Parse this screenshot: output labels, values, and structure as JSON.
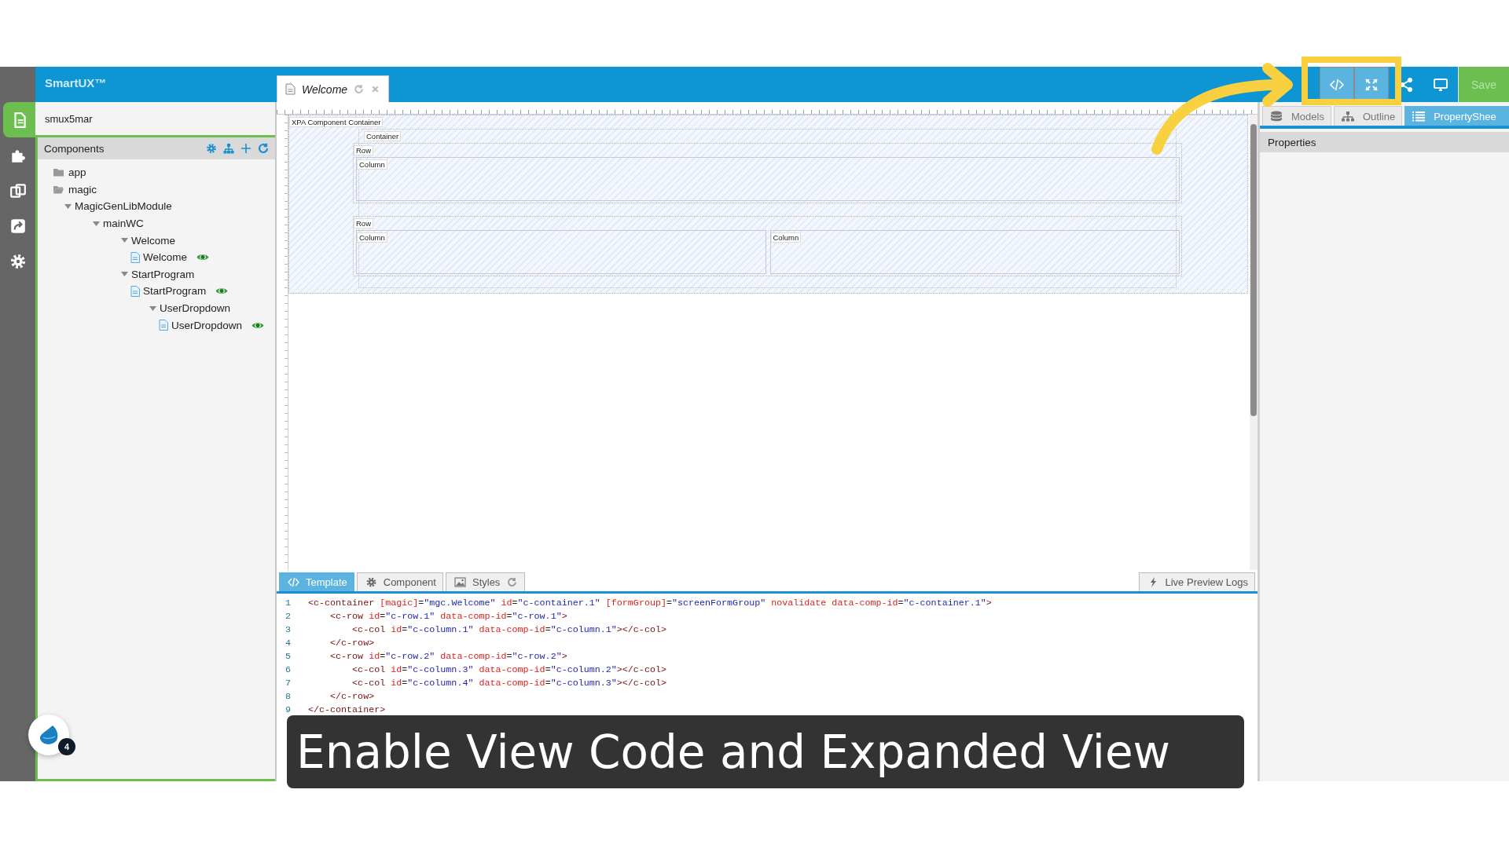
{
  "header": {
    "brand": "SmartUX™"
  },
  "rail": [
    {
      "selected": true
    },
    {
      "selected": false
    },
    {
      "selected": false
    },
    {
      "selected": false
    },
    {
      "selected": false
    }
  ],
  "document_tabs": [
    {
      "title": "Welcome",
      "selected": true
    }
  ],
  "toolbar": [
    {
      "kind": "code",
      "on": true
    },
    {
      "kind": "expand",
      "on": true
    },
    {
      "kind": "share",
      "on": false
    },
    {
      "kind": "monitor",
      "on": false
    }
  ],
  "save_button": {
    "label": "Save",
    "disabled": true
  },
  "project": {
    "name": "smux5mar"
  },
  "components": {
    "title": "Components",
    "tree": [
      {
        "label": "app",
        "kind": "folder",
        "expanded": false
      },
      {
        "label": "magic",
        "kind": "folder",
        "expanded": true,
        "children": [
          {
            "label": "MagicGenLibModule",
            "kind": "group",
            "expanded": true,
            "children": [
              {
                "label": "mainWC",
                "kind": "group",
                "expanded": true,
                "children": [
                  {
                    "label": "Welcome",
                    "kind": "group",
                    "expanded": true,
                    "children": [
                      {
                        "label": "Welcome",
                        "kind": "file",
                        "previewed": true
                      }
                    ]
                  },
                  {
                    "label": "StartProgram",
                    "kind": "group",
                    "expanded": true,
                    "children": [
                      {
                        "label": "StartProgram",
                        "kind": "file",
                        "previewed": true
                      },
                      {
                        "label": "UserDropdown",
                        "kind": "group",
                        "expanded": true,
                        "children": [
                          {
                            "label": "UserDropdown",
                            "kind": "file",
                            "previewed": true
                          }
                        ]
                      }
                    ]
                  }
                ]
              }
            ]
          }
        ]
      }
    ]
  },
  "designer": {
    "label": "XPA Component Container",
    "kind": "root",
    "children": [
      {
        "label": "Container",
        "kind": "container",
        "children": [
          {
            "label": "Row",
            "kind": "row",
            "children": [
              {
                "label": "Column",
                "kind": "column"
              }
            ]
          },
          {
            "label": "Row",
            "kind": "row",
            "children": [
              {
                "label": "Column",
                "kind": "column"
              },
              {
                "label": "Column",
                "kind": "column"
              }
            ]
          }
        ]
      }
    ]
  },
  "editor": {
    "tabs": [
      {
        "label": "Template",
        "selected": true
      },
      {
        "label": "Component",
        "selected": false
      },
      {
        "label": "Styles",
        "selected": false
      }
    ],
    "logs_button": "Live Preview Logs",
    "lines": [
      {
        "number": "1",
        "tokens": [
          {
            "kind": "tag",
            "text": "<c-container "
          },
          {
            "kind": "attr",
            "text": "[magic]"
          },
          {
            "kind": "punct",
            "text": "="
          },
          {
            "kind": "val",
            "text": "\"mgc.Welcome\""
          },
          {
            "kind": "attr",
            "text": " id"
          },
          {
            "kind": "punct",
            "text": "="
          },
          {
            "kind": "val",
            "text": "\"c-container.1\""
          },
          {
            "kind": "attr",
            "text": " [formGroup]"
          },
          {
            "kind": "punct",
            "text": "="
          },
          {
            "kind": "val",
            "text": "\"screenFormGroup\""
          },
          {
            "kind": "attr",
            "text": " novalidate data-comp-id"
          },
          {
            "kind": "punct",
            "text": "="
          },
          {
            "kind": "val",
            "text": "\"c-container.1\""
          },
          {
            "kind": "tag",
            "text": ">"
          }
        ]
      },
      {
        "number": "2",
        "tokens": [
          {
            "kind": "tag",
            "text": "    <c-row "
          },
          {
            "kind": "attr",
            "text": "id"
          },
          {
            "kind": "punct",
            "text": "="
          },
          {
            "kind": "val",
            "text": "\"c-row.1\""
          },
          {
            "kind": "attr",
            "text": " data-comp-id"
          },
          {
            "kind": "punct",
            "text": "="
          },
          {
            "kind": "val",
            "text": "\"c-row.1\""
          },
          {
            "kind": "tag",
            "text": ">"
          }
        ]
      },
      {
        "number": "3",
        "tokens": [
          {
            "kind": "tag",
            "text": "        <c-col "
          },
          {
            "kind": "attr",
            "text": "id"
          },
          {
            "kind": "punct",
            "text": "="
          },
          {
            "kind": "val",
            "text": "\"c-column.1\""
          },
          {
            "kind": "attr",
            "text": " data-comp-id"
          },
          {
            "kind": "punct",
            "text": "="
          },
          {
            "kind": "val",
            "text": "\"c-column.1\""
          },
          {
            "kind": "tag",
            "text": "></c-col>"
          }
        ]
      },
      {
        "number": "4",
        "tokens": [
          {
            "kind": "tag",
            "text": "    </c-row>"
          }
        ]
      },
      {
        "number": "5",
        "tokens": [
          {
            "kind": "tag",
            "text": "    <c-row "
          },
          {
            "kind": "attr",
            "text": "id"
          },
          {
            "kind": "punct",
            "text": "="
          },
          {
            "kind": "val",
            "text": "\"c-row.2\""
          },
          {
            "kind": "attr",
            "text": " data-comp-id"
          },
          {
            "kind": "punct",
            "text": "="
          },
          {
            "kind": "val",
            "text": "\"c-row.2\""
          },
          {
            "kind": "tag",
            "text": ">"
          }
        ]
      },
      {
        "number": "6",
        "tokens": [
          {
            "kind": "tag",
            "text": "        <c-col "
          },
          {
            "kind": "attr",
            "text": "id"
          },
          {
            "kind": "punct",
            "text": "="
          },
          {
            "kind": "val",
            "text": "\"c-column.3\""
          },
          {
            "kind": "attr",
            "text": " data-comp-id"
          },
          {
            "kind": "punct",
            "text": "="
          },
          {
            "kind": "val",
            "text": "\"c-column.2\""
          },
          {
            "kind": "tag",
            "text": "></c-col>"
          }
        ]
      },
      {
        "number": "7",
        "tokens": [
          {
            "kind": "tag",
            "text": "        <c-col "
          },
          {
            "kind": "attr",
            "text": "id"
          },
          {
            "kind": "punct",
            "text": "="
          },
          {
            "kind": "val",
            "text": "\"c-column.4\""
          },
          {
            "kind": "attr",
            "text": " data-comp-id"
          },
          {
            "kind": "punct",
            "text": "="
          },
          {
            "kind": "val",
            "text": "\"c-column.3\""
          },
          {
            "kind": "tag",
            "text": "></c-col>"
          }
        ]
      },
      {
        "number": "8",
        "tokens": [
          {
            "kind": "tag",
            "text": "    </c-row>"
          }
        ]
      },
      {
        "number": "9",
        "tokens": [
          {
            "kind": "tag",
            "text": "</c-container>"
          }
        ]
      }
    ]
  },
  "right_panel": {
    "tabs": [
      {
        "label": "Models",
        "selected": false
      },
      {
        "label": "Outline",
        "selected": false
      },
      {
        "label": "PropertyShee",
        "selected": true
      }
    ],
    "heading": "Properties"
  },
  "assistant": {
    "badge": "4"
  },
  "caption": "Enable View Code and Expanded View"
}
